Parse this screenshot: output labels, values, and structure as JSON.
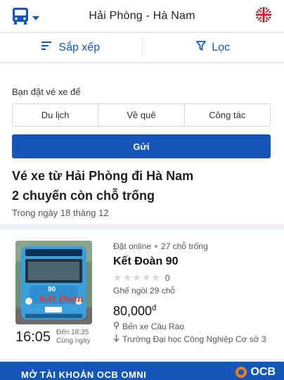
{
  "header": {
    "route": "Hải Phòng - Hà Nam",
    "bus_icon": "bus-icon",
    "language_icon": "uk-flag-icon"
  },
  "toolbar": {
    "sort_label": "Sắp xếp",
    "filter_label": "Lọc"
  },
  "purpose": {
    "question": "Bạn đặt vé xe để",
    "options": [
      "Du lịch",
      "Về quê",
      "Công tác"
    ],
    "submit_label": "Gửi"
  },
  "results": {
    "heading": "Vé xe từ Hải Phòng đi Hà Nam",
    "count_text": "2 chuyến còn chỗ trống",
    "date_text": "Trong ngày 18 tháng 12"
  },
  "trip": {
    "booking_mode": "Đặt online",
    "seats_left": "27 chỗ trống",
    "operator": "Kết Đoàn 90",
    "rating_count": "0",
    "stars": 0,
    "seat_type": "Ghế ngồi 29 chỗ",
    "price": "80,000",
    "currency": "đ",
    "departure_time": "16:05",
    "arrival_time": "Đến 18:35",
    "arrival_day": "Cùng ngày",
    "pickup": "Bến xe Cầu Rào",
    "dropoff": "Trường Đại học Công Nghiệp Cơ sở 3",
    "photo_caption": "Kết Đoàn",
    "photo_number": "90"
  },
  "banner": {
    "text": "MỞ TÀI KHOẢN OCB OMNI",
    "logo": "OCB"
  },
  "colors": {
    "primary": "#1457b8",
    "background": "#eceff3"
  }
}
